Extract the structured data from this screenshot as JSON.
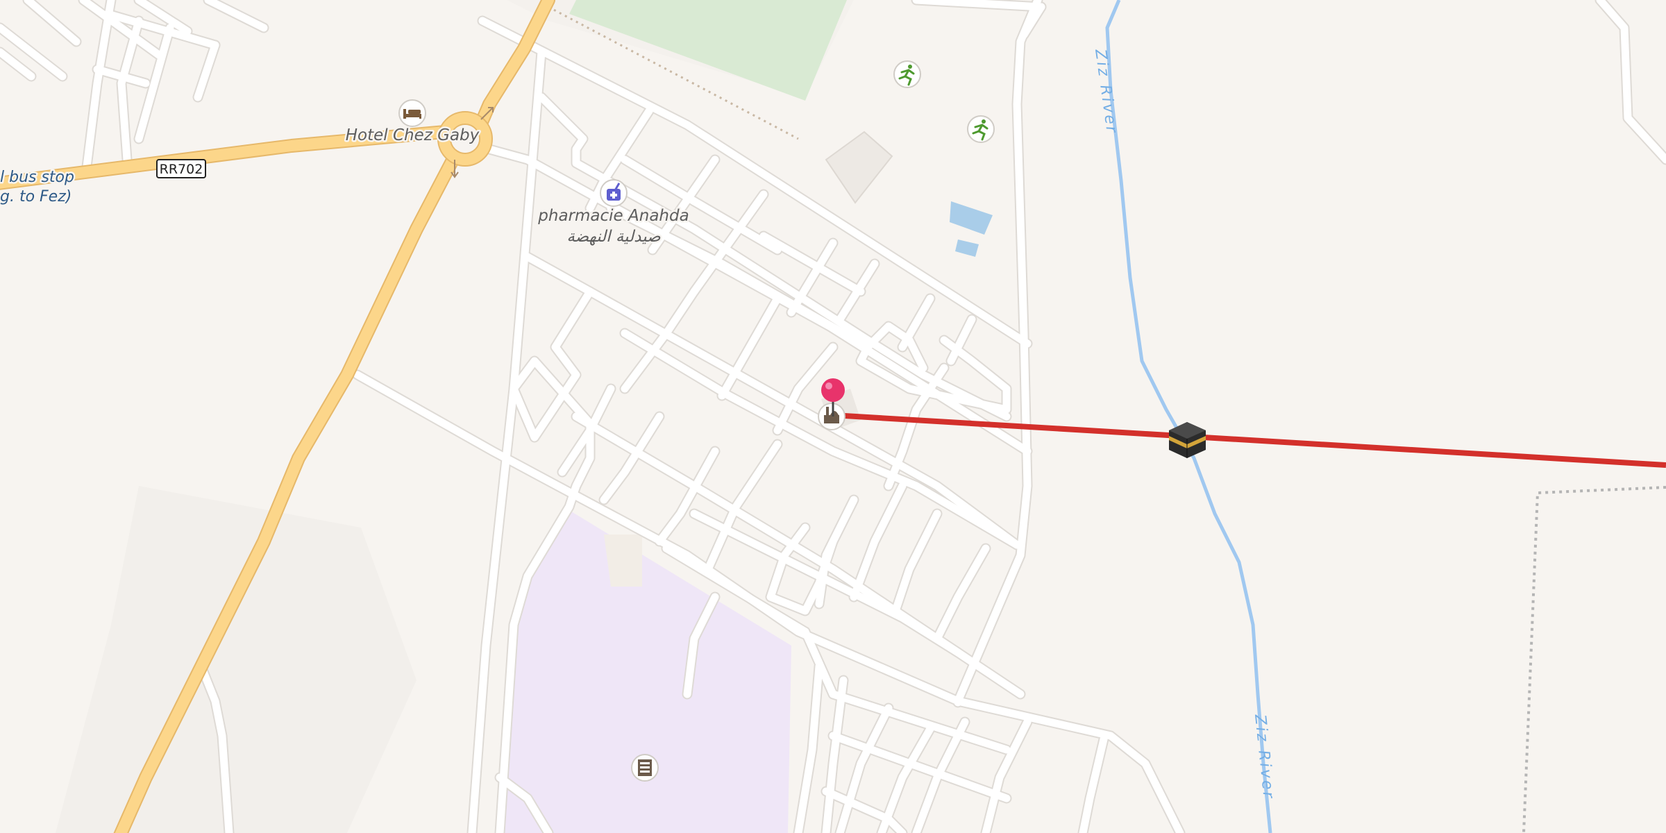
{
  "map": {
    "hotel_label": "Hotel Chez Gaby",
    "road_shield": "RR702",
    "bus_stop_label_line1": "l bus stop",
    "bus_stop_label_line2": "g. to Fez)",
    "pharmacy_label_fr": "pharmacie Anahda",
    "pharmacy_label_ar": "صيدلية النهضة",
    "river_label_upper": "Ziz River",
    "river_label_lower": "Ziz River"
  },
  "colors": {
    "background": "#f7f4f0",
    "primary_road": "#fcd68a",
    "primary_road_casing": "#e6b86a",
    "minor_road": "#ffffff",
    "minor_road_casing": "#dedad5",
    "river": "#a0c8f0",
    "pitch": "#d9ead3",
    "school": "#efe6f7",
    "water_body": "#a9cde9",
    "qibla_line": "#d3302b",
    "pin": "#e8336b"
  },
  "icons": {
    "hotel": "bed-icon",
    "pharmacy": "pharmacy-icon",
    "sport_1": "running-icon",
    "sport_2": "running-icon",
    "mosque": "mosque-icon",
    "school": "school-icon",
    "kaaba": "kaaba-icon",
    "pin": "map-pin-icon",
    "roundabout_arrows": "direction-arrow-icon"
  }
}
